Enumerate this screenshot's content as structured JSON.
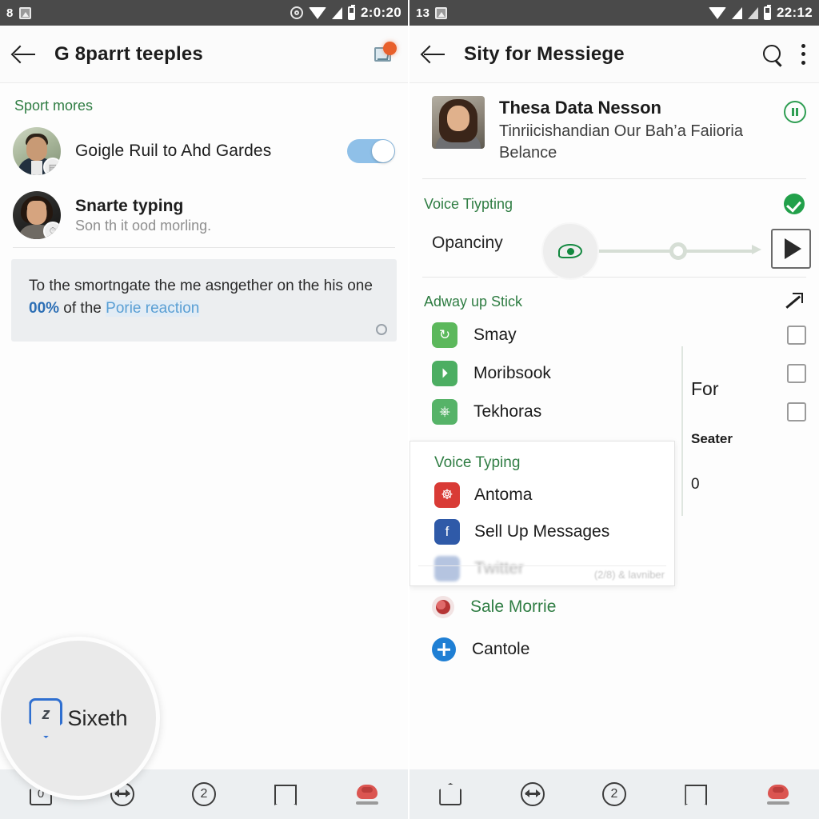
{
  "left": {
    "statusbar": {
      "left_text": "8",
      "pic_icon": "picture-icon",
      "gear_icon": "gear-icon",
      "wifi_icon": "wifi-icon",
      "signal_icon": "signal-icon",
      "battery_icon": "battery-icon",
      "clock": "2:0:20"
    },
    "appbar": {
      "back_icon": "back-arrow-icon",
      "title": "G 8parrt teeples",
      "mail_icon": "mail-badge-icon"
    },
    "section_title": "Sport mores",
    "rows": [
      {
        "title": "Goigle Ruil to Ahd Gardes",
        "subtitle": "",
        "bold": false,
        "toggle": true,
        "avatar": "avatar-man",
        "badge": "chart-badge-icon"
      },
      {
        "title": "Snarte typing",
        "subtitle": "Son th it ood morling.",
        "bold": true,
        "toggle": false,
        "avatar": "avatar-woman",
        "badge": "clock-badge-icon"
      }
    ],
    "info_card": {
      "line1": "To the smortngate the me asngether on the",
      "line2_pre": "his one ",
      "percent": "00%",
      "line2_mid": " of the ",
      "link": "Porie reaction",
      "cog_icon": "gear-icon"
    },
    "bubble": {
      "icon": "shield-badge-icon",
      "glyph": "z",
      "label": "Sixeth"
    },
    "nav": [
      {
        "name": "home",
        "icon": "home-icon",
        "value": "0"
      },
      {
        "name": "arrows",
        "icon": "arrows-icon",
        "value": ""
      },
      {
        "name": "counter",
        "icon": "circle-icon",
        "value": "2"
      },
      {
        "name": "bookmark",
        "icon": "bookmark-icon",
        "value": ""
      },
      {
        "name": "favorite",
        "icon": "heart-icon",
        "value": ""
      }
    ]
  },
  "right": {
    "statusbar": {
      "left_text": "13",
      "pic_icon": "picture-icon",
      "wifi_icon": "wifi-icon",
      "signal_icon": "signal-icon",
      "signal2_icon": "signal-icon",
      "battery_icon": "battery-icon",
      "clock": "22:12"
    },
    "appbar": {
      "back_icon": "back-arrow-icon",
      "title": "Sity for Messiege",
      "search_icon": "search-icon",
      "menu_icon": "kebab-menu-icon"
    },
    "profile": {
      "name": "Thesa Data Nesson",
      "subtitle": "Tinriicishandian Our Bah’a Faiioria Belance",
      "action_icon": "pause-circle-icon",
      "avatar": "avatar-woman-thumb"
    },
    "voice_section": {
      "title": "Voice Tiypting",
      "status_icon": "check-circle-icon",
      "row_label": "Opanciny",
      "eye_icon": "eye-icon",
      "slider_icon": "double-arrow-slider",
      "play_icon": "play-button-icon"
    },
    "adway_section": {
      "title": "Adway up Stick",
      "expand_icon": "arrow-northeast-icon",
      "items": [
        {
          "label": "Smay",
          "icon": "sync-icon",
          "checked": false
        },
        {
          "label": "Moribsook",
          "icon": "play-badge-icon",
          "checked": false
        },
        {
          "label": "Tekhoras",
          "icon": "table-icon",
          "checked": false
        }
      ],
      "side_notes": [
        "For",
        "Seater",
        "0"
      ]
    },
    "dropdown": {
      "title": "Voice Typing",
      "items": [
        {
          "label": "Antoma",
          "icon": "red-app-icon"
        },
        {
          "label": "Sell Up Messages",
          "icon": "facebook-icon"
        }
      ],
      "cut_label": "Twitter",
      "footnote": "(2/8) & lavniber"
    },
    "tail_rows": [
      {
        "label": "Sale Morrie",
        "icon": "rose-icon",
        "green": true
      },
      {
        "label": "Cantole",
        "icon": "plus-circle-icon",
        "green": false
      }
    ],
    "nav": [
      {
        "name": "home",
        "icon": "home-icon",
        "value": ""
      },
      {
        "name": "arrows",
        "icon": "arrows-icon",
        "value": ""
      },
      {
        "name": "counter",
        "icon": "circle-icon",
        "value": "2"
      },
      {
        "name": "bookmark",
        "icon": "bookmark-icon",
        "value": ""
      },
      {
        "name": "favorite",
        "icon": "heart-icon",
        "value": ""
      }
    ]
  }
}
